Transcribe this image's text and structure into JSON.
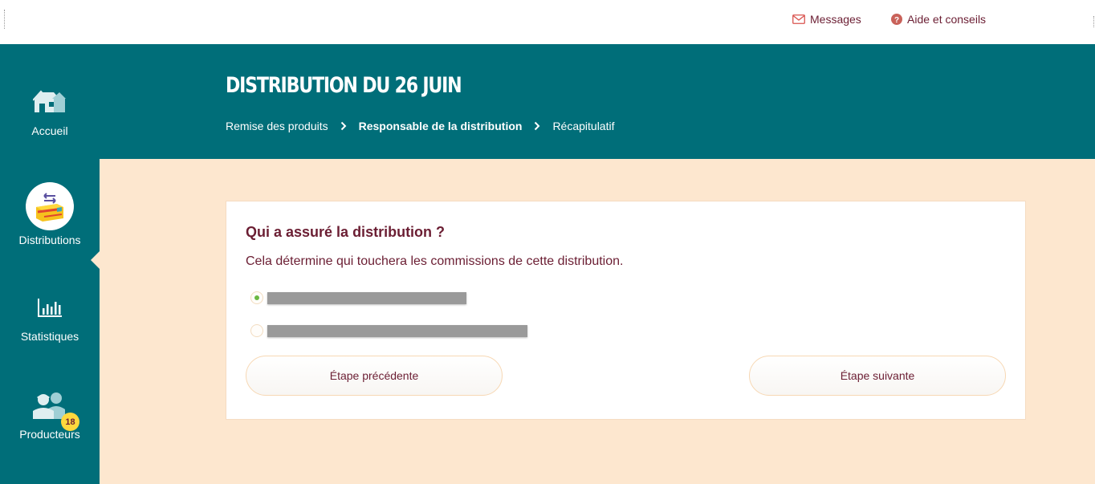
{
  "topbar": {
    "messages_label": "Messages",
    "help_label": "Aide et conseils",
    "messages_icon": "envelope-icon",
    "help_icon": "question-circle-icon"
  },
  "sidebar": {
    "items": [
      {
        "label": "Accueil",
        "icon": "home-icon"
      },
      {
        "label": "Distributions",
        "icon": "distributions-icon",
        "active": true
      },
      {
        "label": "Statistiques",
        "icon": "bar-chart-icon"
      },
      {
        "label": "Producteurs",
        "icon": "producers-icon",
        "badge": "18"
      }
    ]
  },
  "header": {
    "title": "DISTRIBUTION DU 26 JUIN",
    "breadcrumb": [
      "Remise des produits",
      "Responsable de la distribution",
      "Récapitulatif"
    ],
    "current_step": 1
  },
  "form": {
    "question": "Qui a assuré la distribution ?",
    "description": "Cela détermine qui touchera les commissions de cette distribution.",
    "options": [
      {
        "label": "",
        "selected": true,
        "redacted": true
      },
      {
        "label": "",
        "selected": false,
        "redacted": true
      }
    ],
    "prev_label": "Étape précédente",
    "next_label": "Étape suivante"
  },
  "colors": {
    "primary_teal": "#006e79",
    "content_bg": "#fde7cf",
    "text_maroon": "#6b1e33",
    "badge_yellow": "#ffd83d",
    "radio_selected": "#6bb842"
  }
}
